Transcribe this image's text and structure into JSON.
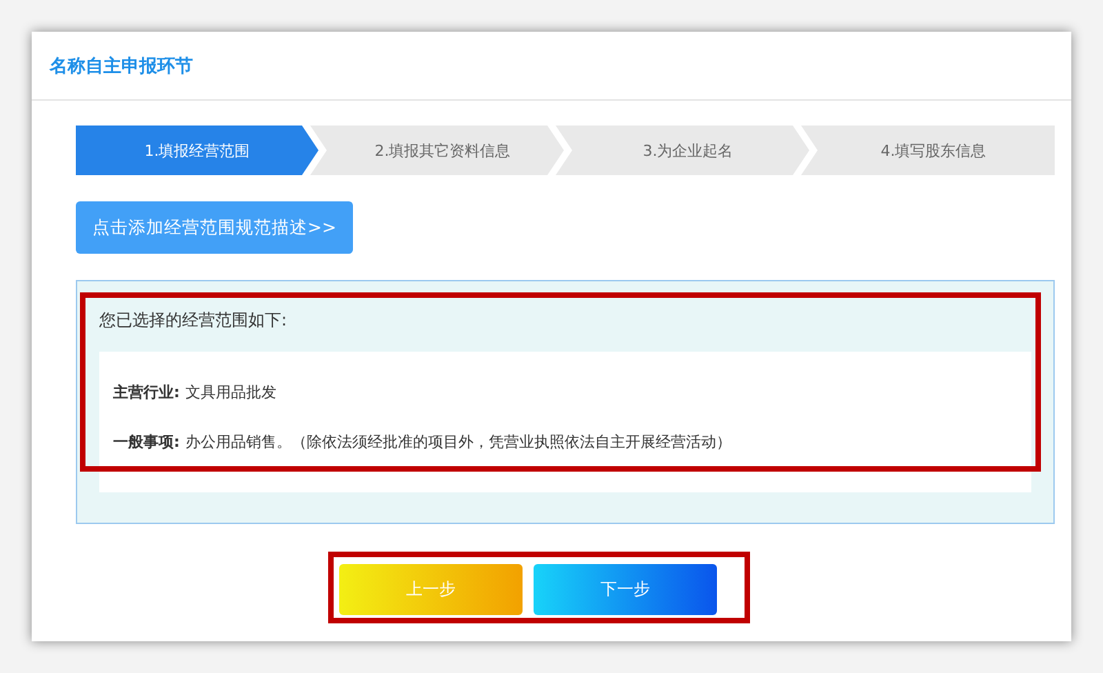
{
  "header": {
    "title": "名称自主申报环节"
  },
  "steps": [
    {
      "label": "1.填报经营范围",
      "selected": true
    },
    {
      "label": "2.填报其它资料信息",
      "selected": false
    },
    {
      "label": "3.为企业起名",
      "selected": false
    },
    {
      "label": "4.填写股东信息",
      "selected": false
    }
  ],
  "add_button": "点击添加经营范围规范描述>>",
  "scope_panel": {
    "heading": "您已选择的经营范围如下:",
    "items": [
      {
        "label": "主营行业:",
        "value": "文具用品批发"
      },
      {
        "label": "一般事项:",
        "value": "办公用品销售。（除依法须经批准的项目外，凭营业执照依法自主开展经营活动）"
      }
    ]
  },
  "buttons": [
    {
      "label": "上一步",
      "kind": "prev"
    },
    {
      "label": "下一步",
      "kind": "next"
    }
  ]
}
